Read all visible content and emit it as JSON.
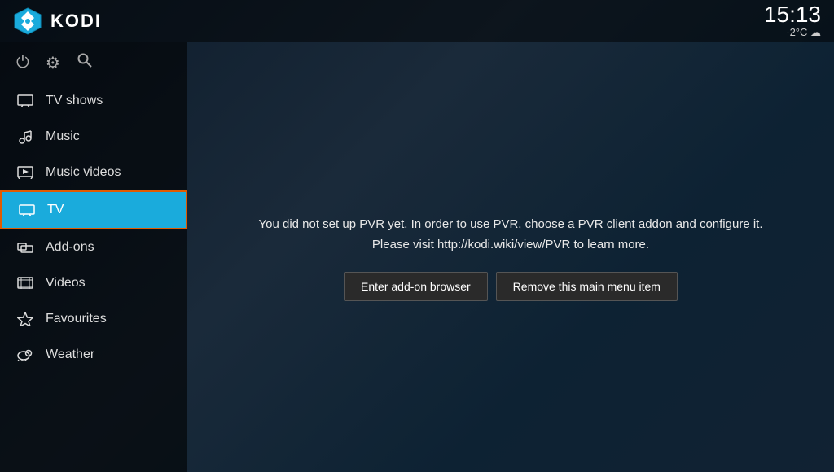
{
  "app": {
    "title": "KODI"
  },
  "clock": {
    "time": "15:13",
    "weather": "-2°C ☁"
  },
  "sidebar": {
    "controls": [
      {
        "name": "power-icon",
        "symbol": "⏻"
      },
      {
        "name": "settings-icon",
        "symbol": "⚙"
      },
      {
        "name": "search-icon",
        "symbol": "🔍"
      }
    ],
    "items": [
      {
        "id": "tv-shows",
        "label": "TV shows",
        "icon": "tv-shows-icon",
        "active": false
      },
      {
        "id": "music",
        "label": "Music",
        "icon": "music-icon",
        "active": false
      },
      {
        "id": "music-videos",
        "label": "Music videos",
        "icon": "music-videos-icon",
        "active": false
      },
      {
        "id": "tv",
        "label": "TV",
        "icon": "tv-icon",
        "active": true
      },
      {
        "id": "add-ons",
        "label": "Add-ons",
        "icon": "addons-icon",
        "active": false
      },
      {
        "id": "videos",
        "label": "Videos",
        "icon": "videos-icon",
        "active": false
      },
      {
        "id": "favourites",
        "label": "Favourites",
        "icon": "favourites-icon",
        "active": false
      },
      {
        "id": "weather",
        "label": "Weather",
        "icon": "weather-icon",
        "active": false
      }
    ]
  },
  "pvr": {
    "message_line1": "You did not set up PVR yet. In order to use PVR, choose a PVR client addon and configure it.",
    "message_line2": "Please visit http://kodi.wiki/view/PVR to learn more.",
    "button_addon_browser": "Enter add-on browser",
    "button_remove_item": "Remove this main menu item"
  }
}
